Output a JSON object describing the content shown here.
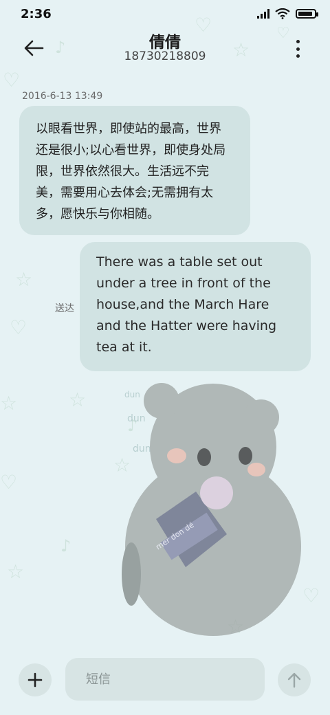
{
  "status_bar": {
    "time": "2:36",
    "icons": [
      "signal-icon",
      "wifi-icon",
      "battery-icon"
    ]
  },
  "header": {
    "contact_name": "倩倩",
    "contact_number": "18730218809",
    "icons": [
      "back-arrow-icon",
      "more-vertical-icon"
    ]
  },
  "conversation": {
    "timestamp": "2016-6-13 13:49",
    "messages": [
      {
        "direction": "incoming",
        "text": "以眼看世界，即使站的最高，世界还是很小;以心看世界，即使身处局限，世界依然很大。生活远不完美，需要用心去体会;无需拥有太多，愿快乐与你相随。"
      },
      {
        "direction": "outgoing",
        "text": "There was a table set out under a tree in front of the house,and the March Hare and the Hatter were having tea at it.",
        "status": "送达"
      }
    ]
  },
  "wallpaper": {
    "captions": [
      "dun",
      "dun",
      "dun"
    ],
    "label": "mer don dé"
  },
  "composer": {
    "placeholder": "短信",
    "icons": [
      "add-icon",
      "send-arrow-icon"
    ]
  },
  "colors": {
    "background": "#e6f2f4",
    "bubble": "#d1e3e3",
    "button": "#d7e4e4",
    "decor": "#cfe3dd"
  }
}
